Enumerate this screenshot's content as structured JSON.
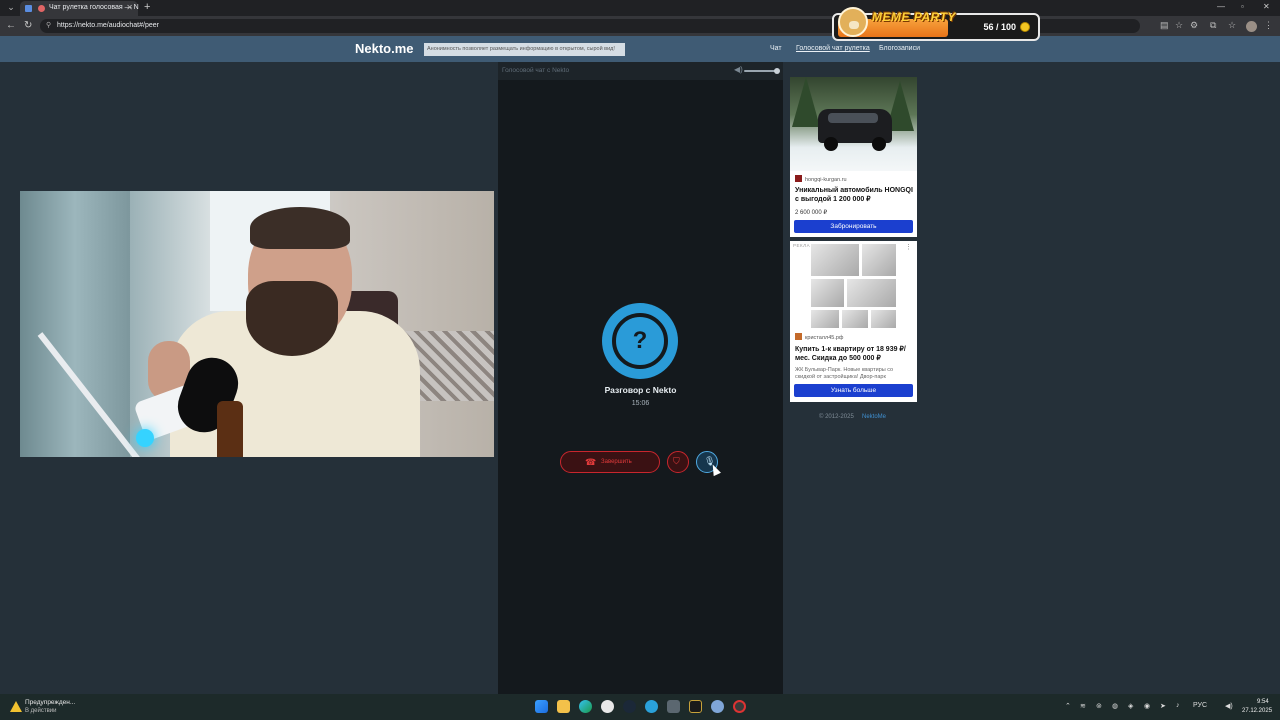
{
  "browser": {
    "tab_title": "Чат рулетка голосовая — N",
    "url": "https://nekto.me/audiochat#/peer"
  },
  "overlay": {
    "title": "MEME PARTY",
    "count": "56 / 100"
  },
  "site": {
    "logo": "Nekto.me",
    "notice": "Анонимность позволяет размещать информацию в открытом, сырой вид!",
    "nav": [
      "Чат",
      "Голосовой чат рулетка",
      "Блогозаписи"
    ]
  },
  "chat": {
    "panel_title": "Голосовой чат с Nekto",
    "avatar_symbol": "?",
    "conversation_title": "Разговор с Nekto",
    "timer": "15:06",
    "end_label": "Завершить"
  },
  "ads": [
    {
      "source": "hongqi-kurgan.ru",
      "headline": "Уникальный автомобиль HONGQI с выгодой 1 200 000 ₽",
      "price": "2 600 000 ₽",
      "cta": "Забронировать"
    },
    {
      "label": "РЕКЛАМА",
      "source": "кристалл45.рф",
      "headline": "Купить 1-к квартиру от 18 939 ₽/мес. Скидка до 500 000 ₽",
      "desc": "ЖК Бульвар-Парк. Новые квартиры со скидкой от застройщика! Двор-парк",
      "cta": "Узнать больше"
    }
  ],
  "footer": {
    "copyright": "© 2012-2025",
    "link": "NektoMe"
  },
  "taskbar": {
    "notification_title": "Предупрежден...",
    "notification_sub": "В действии",
    "lang": "РУС",
    "time": "9:54",
    "date": "27.12.2025"
  },
  "colors": {
    "accent": "#2a9bd8",
    "danger": "#e23b3b",
    "header": "#3f5b74",
    "cta": "#1b3fcf"
  }
}
